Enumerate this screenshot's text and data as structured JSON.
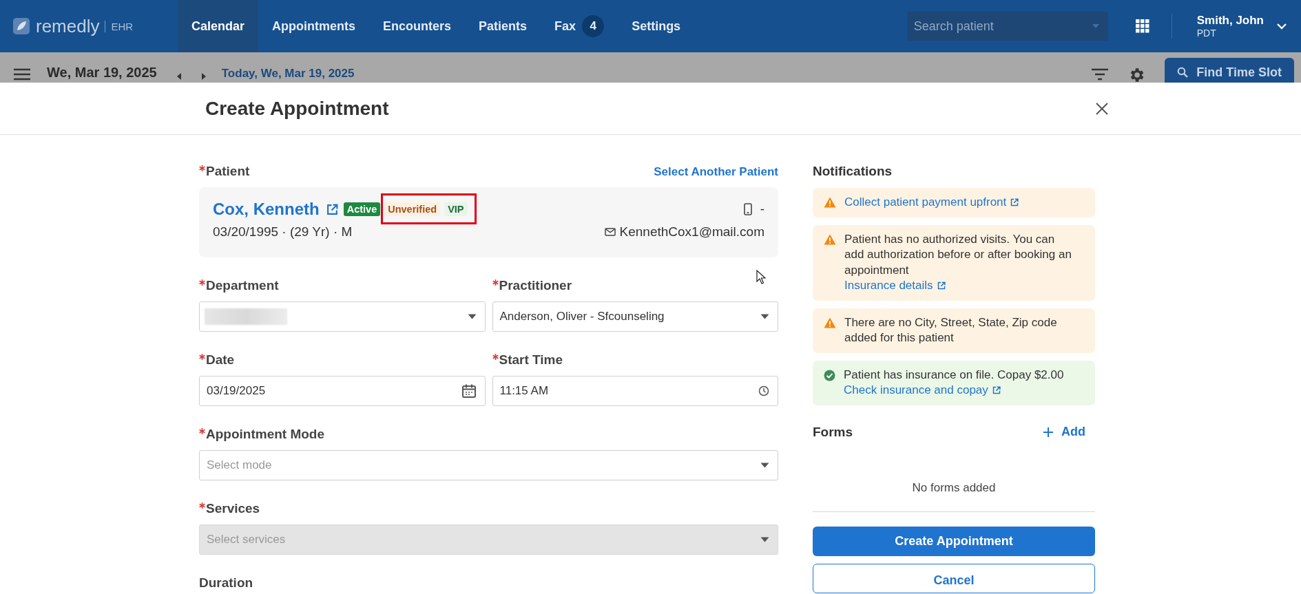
{
  "app": {
    "logo": "remedly",
    "suffix": "EHR"
  },
  "nav": [
    {
      "label": "Calendar",
      "selected": true
    },
    {
      "label": "Appointments",
      "selected": false
    },
    {
      "label": "Encounters",
      "selected": false
    },
    {
      "label": "Patients",
      "selected": false
    },
    {
      "label": "Fax",
      "selected": false,
      "badge": "4"
    },
    {
      "label": "Settings",
      "selected": false
    }
  ],
  "search": {
    "placeholder": "Search patient"
  },
  "user": {
    "name": "Smith, John",
    "timezone": "PDT"
  },
  "toolbar": {
    "date": "We, Mar 19, 2025",
    "today_link": "Today, We, Mar 19, 2025",
    "find_button": "Find Time Slot"
  },
  "dialog": {
    "title": "Create Appointment"
  },
  "patient": {
    "label": "Patient",
    "required": true,
    "select_link": "Select Another Patient",
    "name": "Cox, Kenneth",
    "badges": [
      {
        "label": "Active",
        "kind": "active"
      },
      {
        "label": "Unverified",
        "kind": "warning"
      },
      {
        "label": "VIP",
        "kind": "vip"
      }
    ],
    "details": "03/20/1995 · (29 Yr) · M",
    "phone": "-",
    "email": "KennethCox1@mail.com"
  },
  "field_rows": [
    [
      {
        "label": "Department",
        "required": true,
        "kind": "select",
        "redacted": true,
        "disabled": false
      },
      {
        "label": "Practitioner",
        "required": true,
        "kind": "select",
        "value": "Anderson, Oliver - Sfcounseling",
        "disabled": false
      }
    ],
    [
      {
        "label": "Date",
        "required": true,
        "kind": "date",
        "value": "03/19/2025",
        "disabled": false
      },
      {
        "label": "Start Time",
        "required": true,
        "kind": "time",
        "value": "11:15 AM",
        "disabled": false
      }
    ],
    [
      {
        "label": "Appointment Mode",
        "required": true,
        "kind": "select",
        "placeholder": "Select mode",
        "disabled": false
      }
    ],
    [
      {
        "label": "Services",
        "required": true,
        "kind": "select",
        "placeholder": "Select services",
        "disabled": true
      }
    ]
  ],
  "duration_label": "Duration",
  "notifications": {
    "title": "Notifications",
    "items": [
      {
        "kind": "warning",
        "link": "Collect patient payment upfront"
      },
      {
        "kind": "warning",
        "text": "Patient has no authorized visits. You can add authorization before or after booking an appointment",
        "link": "Insurance details"
      },
      {
        "kind": "warning",
        "text": "There are no City, Street, State, Zip code added for this patient"
      },
      {
        "kind": "success",
        "text": "Patient has insurance on file. Copay $2.00",
        "link": "Check insurance and copay"
      }
    ]
  },
  "forms": {
    "title": "Forms",
    "add_label": "Add",
    "empty": "No forms added"
  },
  "buttons": {
    "primary": "Create Appointment",
    "secondary": "Cancel"
  }
}
